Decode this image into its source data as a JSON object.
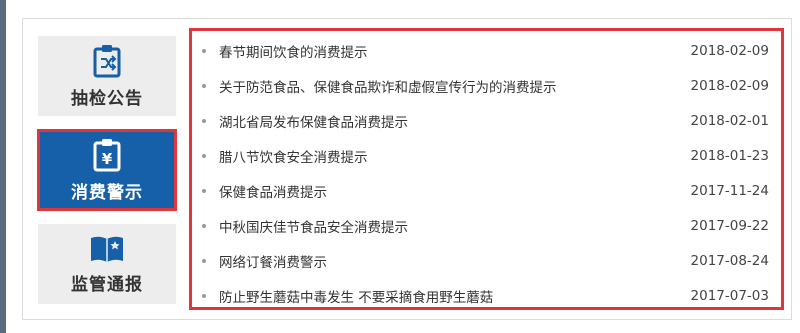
{
  "tabs": [
    {
      "label": "抽检公告",
      "icon": "clipboard-shuffle-icon",
      "active": false
    },
    {
      "label": "消费警示",
      "icon": "clipboard-yen-icon",
      "active": true
    },
    {
      "label": "监管通报",
      "icon": "open-book-star-icon",
      "active": false
    }
  ],
  "news": [
    {
      "title": "春节期间饮食的消费提示",
      "date": "2018-02-09"
    },
    {
      "title": "关于防范食品、保健食品欺诈和虚假宣传行为的消费提示",
      "date": "2018-02-09"
    },
    {
      "title": "湖北省局发布保健食品消费提示",
      "date": "2018-02-01"
    },
    {
      "title": "腊八节饮食安全消费提示",
      "date": "2018-01-23"
    },
    {
      "title": "保健食品消费提示",
      "date": "2017-11-24"
    },
    {
      "title": "中秋国庆佳节食品安全消费提示",
      "date": "2017-09-22"
    },
    {
      "title": "网络订餐消费警示",
      "date": "2017-08-24"
    },
    {
      "title": "防止野生蘑菇中毒发生 不要采摘食用野生蘑菇",
      "date": "2017-07-03"
    }
  ],
  "colors": {
    "accent": "#1560a8",
    "highlight": "#e0353a",
    "tab_bg": "#ededed"
  }
}
